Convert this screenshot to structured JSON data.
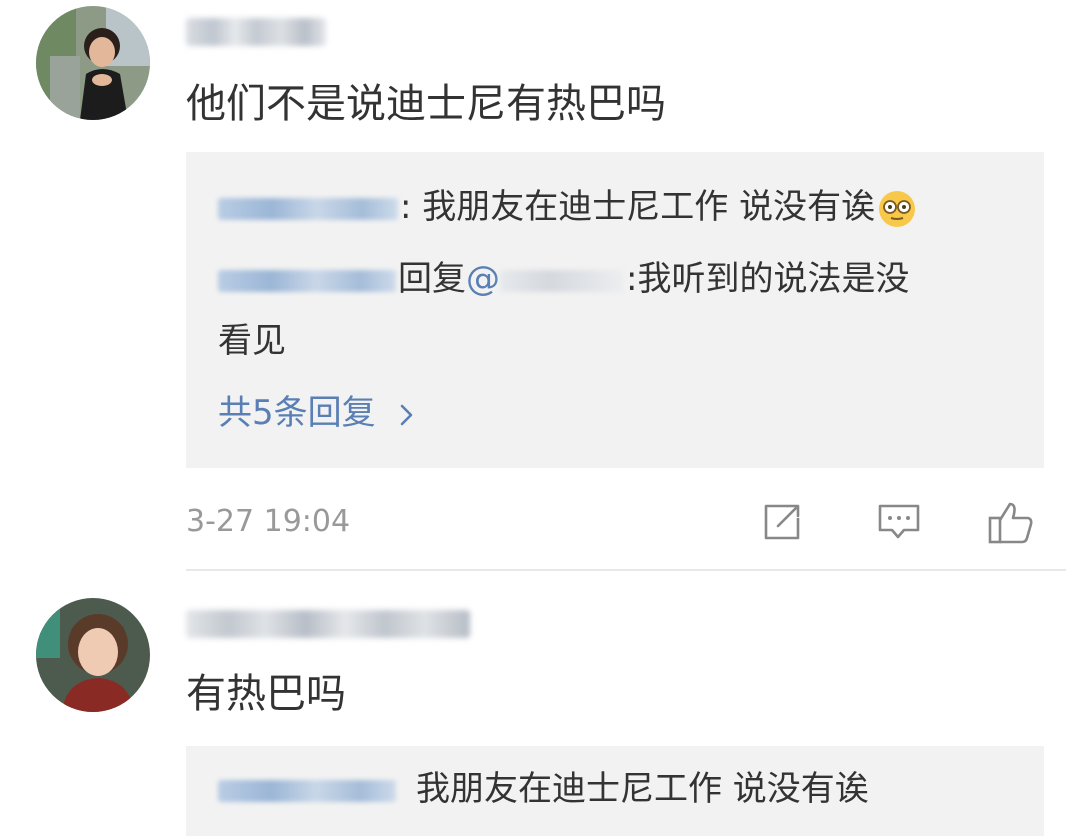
{
  "comments": [
    {
      "text": "他们不是说迪士尼有热巴吗",
      "replies": [
        {
          "text": ": 我朋友在迪士尼工作 说没有诶"
        },
        {
          "reply_word": "回复",
          "mention": "@",
          "text": ":我听到的说法是没",
          "text_wrap": "看见"
        }
      ],
      "more_replies": "共5条回复",
      "timestamp": "3-27 19:04",
      "icons": [
        "share-icon",
        "comment-icon",
        "like-icon"
      ]
    },
    {
      "text": "有热巴吗",
      "replies": [
        {
          "text": "我朋友在迪士尼工作 说没有诶"
        }
      ]
    }
  ],
  "colors": {
    "link": "#5a7fb4",
    "reply_bg": "#f2f2f2",
    "timestamp": "#999999",
    "text": "#333333"
  }
}
